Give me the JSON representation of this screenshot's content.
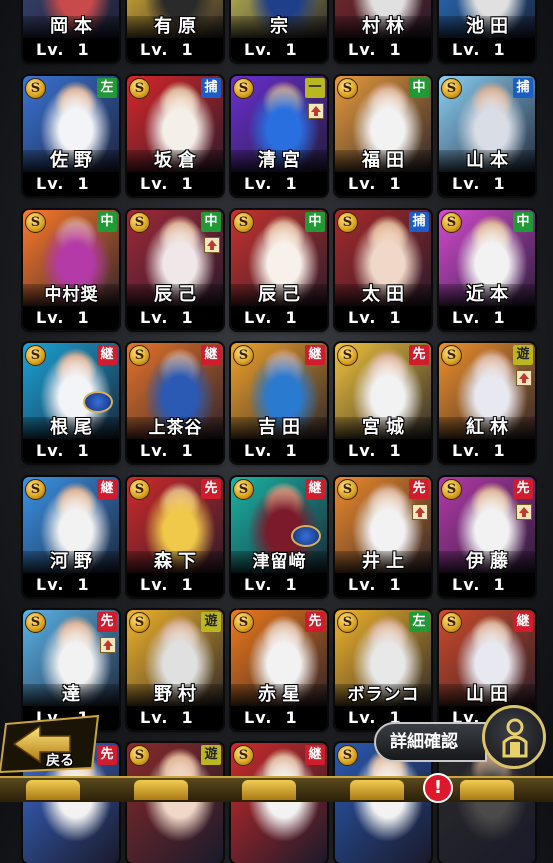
{
  "cards": [
    {
      "name": "岡本",
      "lv": "Lv.  1",
      "pos": "",
      "pos_color": "",
      "coin": "S",
      "up": false,
      "art": [
        "#3c4a7a",
        "#c84a4a"
      ],
      "partial": true
    },
    {
      "name": "有原",
      "lv": "Lv.  1",
      "pos": "",
      "pos_color": "",
      "coin": "S",
      "up": false,
      "art": [
        "#f0c233",
        "#2a2a2a"
      ],
      "partial": true
    },
    {
      "name": "宗",
      "lv": "Lv.  1",
      "pos": "",
      "pos_color": "",
      "coin": "S",
      "up": false,
      "art": [
        "#d8d05a",
        "#1f3f8a"
      ],
      "partial": true
    },
    {
      "name": "村林",
      "lv": "Lv.  1",
      "pos": "",
      "pos_color": "",
      "coin": "S",
      "up": false,
      "art": [
        "#8a2a2a",
        "#e0e0e0"
      ],
      "partial": true
    },
    {
      "name": "池田",
      "lv": "Lv.  1",
      "pos": "",
      "pos_color": "",
      "coin": "S",
      "up": false,
      "art": [
        "#2a7ad0",
        "#e0e0e0"
      ],
      "partial": true
    },
    {
      "name": "佐野",
      "lv": "Lv.  1",
      "pos": "左",
      "pos_color": "green",
      "coin": "S",
      "up": false,
      "art": [
        "#3a74d6",
        "#f2f4f8"
      ]
    },
    {
      "name": "坂倉",
      "lv": "Lv.  1",
      "pos": "捕",
      "pos_color": "blue",
      "coin": "S",
      "up": false,
      "art": [
        "#d8262a",
        "#f4efe8"
      ]
    },
    {
      "name": "清宮",
      "lv": "Lv.  1",
      "pos": "一",
      "pos_color": "olive",
      "coin": "S",
      "up": true,
      "art": [
        "#6a2fd0",
        "#2a6fe0"
      ]
    },
    {
      "name": "福田",
      "lv": "Lv.  1",
      "pos": "中",
      "pos_color": "green",
      "coin": "S",
      "up": false,
      "art": [
        "#e89a3a",
        "#f2f2f2"
      ]
    },
    {
      "name": "山本",
      "lv": "Lv.  1",
      "pos": "捕",
      "pos_color": "blue",
      "coin": "S",
      "up": false,
      "art": [
        "#8ad0f4",
        "#d8dde6"
      ]
    },
    {
      "name": "中村奨",
      "lv": "Lv.  1",
      "pos": "中",
      "pos_color": "green",
      "coin": "S",
      "up": false,
      "art": [
        "#ff7a2a",
        "#b43aa8"
      ]
    },
    {
      "name": "辰己",
      "lv": "Lv.  1",
      "pos": "中",
      "pos_color": "green",
      "coin": "S",
      "up": true,
      "art": [
        "#a02838",
        "#f0e8e8"
      ]
    },
    {
      "name": "辰己",
      "lv": "Lv.  1",
      "pos": "中",
      "pos_color": "green",
      "coin": "S",
      "up": false,
      "art": [
        "#c8322e",
        "#f8f0ea"
      ]
    },
    {
      "name": "太田",
      "lv": "Lv.  1",
      "pos": "捕",
      "pos_color": "blue",
      "coin": "S",
      "up": false,
      "art": [
        "#a82a2a",
        "#f0d8c8"
      ]
    },
    {
      "name": "近本",
      "lv": "Lv.  1",
      "pos": "中",
      "pos_color": "green",
      "coin": "S",
      "up": false,
      "art": [
        "#d44ad0",
        "#f2f2f2"
      ]
    },
    {
      "name": "根尾",
      "lv": "Lv.  1",
      "pos": "継",
      "pos_color": "red",
      "coin": "S",
      "up": false,
      "art": [
        "#1aa4d8",
        "#f2f4f8"
      ],
      "junior": true
    },
    {
      "name": "上茶谷",
      "lv": "Lv.  1",
      "pos": "継",
      "pos_color": "red",
      "coin": "S",
      "up": false,
      "art": [
        "#e8742a",
        "#2a5ab4"
      ]
    },
    {
      "name": "吉田",
      "lv": "Lv.  1",
      "pos": "継",
      "pos_color": "red",
      "coin": "S",
      "up": false,
      "art": [
        "#f0a22a",
        "#2a7ad0"
      ]
    },
    {
      "name": "宮城",
      "lv": "Lv.  1",
      "pos": "先",
      "pos_color": "red",
      "coin": "S",
      "up": false,
      "art": [
        "#f0c23a",
        "#f2f2f2"
      ]
    },
    {
      "name": "紅林",
      "lv": "Lv.  1",
      "pos": "遊",
      "pos_color": "olive",
      "coin": "S",
      "up": true,
      "art": [
        "#f0902a",
        "#e8e8f0"
      ]
    },
    {
      "name": "河野",
      "lv": "Lv.  1",
      "pos": "継",
      "pos_color": "red",
      "coin": "S",
      "up": false,
      "art": [
        "#3a94e8",
        "#f2f2f2"
      ]
    },
    {
      "name": "森下",
      "lv": "Lv.  1",
      "pos": "先",
      "pos_color": "red",
      "coin": "S",
      "up": false,
      "art": [
        "#d02a2a",
        "#f0c84a"
      ]
    },
    {
      "name": "津留﨑",
      "lv": "Lv.  1",
      "pos": "継",
      "pos_color": "red",
      "coin": "S",
      "up": false,
      "art": [
        "#1ab4a4",
        "#7a1a2a"
      ],
      "junior": true
    },
    {
      "name": "井上",
      "lv": "Lv.  1",
      "pos": "先",
      "pos_color": "red",
      "coin": "S",
      "up": true,
      "art": [
        "#f08a2a",
        "#f2f2f2"
      ]
    },
    {
      "name": "伊藤",
      "lv": "Lv.  1",
      "pos": "先",
      "pos_color": "red",
      "coin": "S",
      "up": true,
      "art": [
        "#b43aa8",
        "#f2f2f2"
      ]
    },
    {
      "name": "達",
      "lv": "Lv.  1",
      "pos": "先",
      "pos_color": "red",
      "coin": "S",
      "up": true,
      "art": [
        "#5ab4e8",
        "#f2f2f2"
      ]
    },
    {
      "name": "野村",
      "lv": "Lv.  1",
      "pos": "遊",
      "pos_color": "olive",
      "coin": "S",
      "up": false,
      "art": [
        "#f0b42a",
        "#e0e0e0"
      ]
    },
    {
      "name": "赤星",
      "lv": "Lv.  1",
      "pos": "先",
      "pos_color": "red",
      "coin": "S",
      "up": false,
      "art": [
        "#f07a1a",
        "#f2f2f2"
      ]
    },
    {
      "name": "ボランコ",
      "lv": "Lv.  1",
      "pos": "左",
      "pos_color": "green",
      "coin": "S",
      "up": false,
      "art": [
        "#f0b42a",
        "#e8e8e8"
      ]
    },
    {
      "name": "山田",
      "lv": "Lv.  1",
      "pos": "継",
      "pos_color": "red",
      "coin": "S",
      "up": false,
      "art": [
        "#d04a2a",
        "#e8e8f0"
      ]
    },
    {
      "name": "",
      "lv": "",
      "pos": "先",
      "pos_color": "red",
      "coin": "",
      "up": false,
      "art": [
        "#3a6ad0",
        "#f2f2f2"
      ],
      "partial": true
    },
    {
      "name": "",
      "lv": "",
      "pos": "遊",
      "pos_color": "olive",
      "coin": "S",
      "up": false,
      "art": [
        "#8a2a2a",
        "#f0d8c8"
      ],
      "partial": true
    },
    {
      "name": "",
      "lv": "",
      "pos": "継",
      "pos_color": "red",
      "coin": "S",
      "up": false,
      "art": [
        "#d02a2a",
        "#f2f2f2"
      ],
      "partial": true
    },
    {
      "name": "",
      "lv": "",
      "pos": "",
      "pos_color": "",
      "coin": "S",
      "up": false,
      "art": [
        "#2a5ab4",
        "#f2f2f2"
      ],
      "partial": true
    },
    {
      "name": "",
      "lv": "",
      "pos": "",
      "pos_color": "",
      "coin": "",
      "up": false,
      "art": [
        "#2a2a2a",
        "#4a4a4a"
      ],
      "partial": true
    }
  ],
  "ui": {
    "back_label": "戻る",
    "detail_label": "詳細確認",
    "alert": "!",
    "accent_gold": "#d9c46a"
  }
}
